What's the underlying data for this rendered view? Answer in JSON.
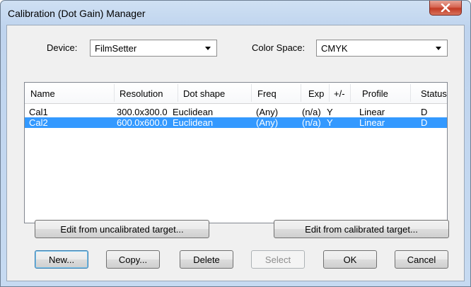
{
  "window": {
    "title": "Calibration (Dot Gain) Manager"
  },
  "device": {
    "label": "Device:",
    "value": "FilmSetter"
  },
  "color_space": {
    "label": "Color Space:",
    "value": "CMYK"
  },
  "list": {
    "columns": [
      "Name",
      "Resolution",
      "Dot shape",
      "Freq",
      "Exp",
      "+/-",
      "Profile",
      "Status"
    ],
    "rows": [
      {
        "name": "Cal1",
        "resolution": "300.0x300.0",
        "dot_shape": "Euclidean",
        "freq": "(Any)",
        "exp": "(n/a)",
        "plusminus": "Y",
        "profile": "Linear",
        "status": "D",
        "selected": false
      },
      {
        "name": "Cal2",
        "resolution": "600.0x600.0",
        "dot_shape": "Euclidean",
        "freq": "(Any)",
        "exp": "(n/a)",
        "plusminus": "Y",
        "profile": "Linear",
        "status": "D",
        "selected": true
      }
    ]
  },
  "buttons": {
    "edit_uncalibrated": "Edit from uncalibrated target...",
    "edit_calibrated": "Edit from calibrated target...",
    "new": "New...",
    "copy": "Copy...",
    "delete": "Delete",
    "select": "Select",
    "ok": "OK",
    "cancel": "Cancel"
  },
  "icons": {
    "close": "close-icon",
    "dropdown": "chevron-down-icon"
  },
  "colors": {
    "selection": "#3399ff",
    "close_button": "#c33b24"
  }
}
